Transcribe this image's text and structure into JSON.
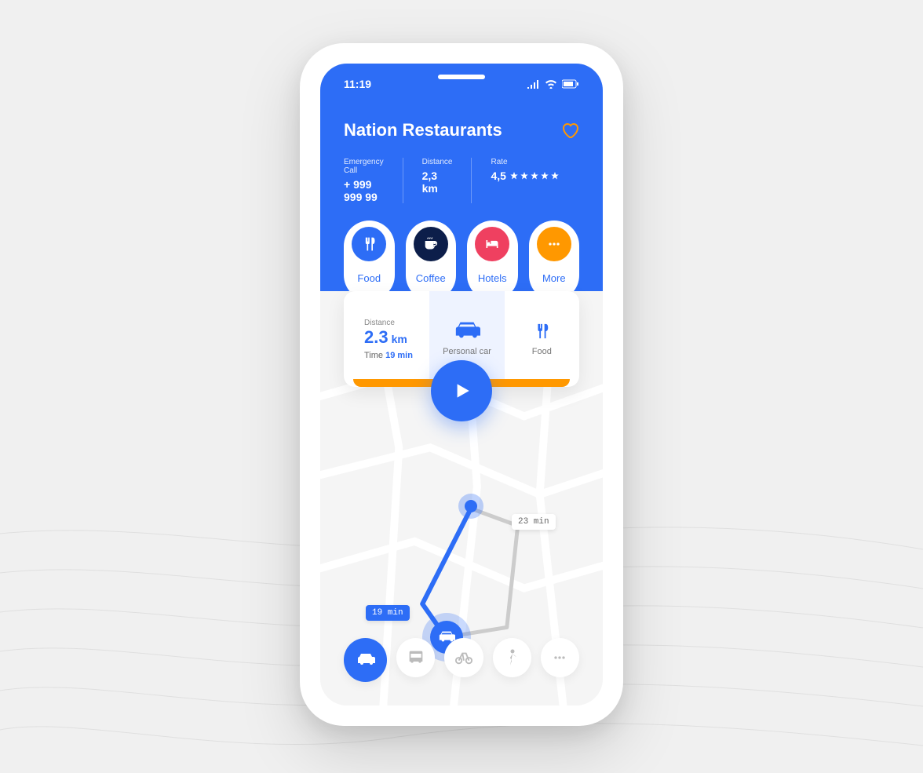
{
  "status": {
    "time": "11:19"
  },
  "place": {
    "title": "Nation Restaurants",
    "emergency_label": "Emergency Call",
    "emergency_number": "+ 999 999 99",
    "distance_label": "Distance",
    "distance_value": "2,3 km",
    "rate_label": "Rate",
    "rate_value": "4,5"
  },
  "categories": [
    {
      "label": "Food",
      "icon": "food",
      "color": "#2d6df6"
    },
    {
      "label": "Coffee",
      "icon": "coffee",
      "color": "#0c1e4a"
    },
    {
      "label": "Hotels",
      "icon": "bed",
      "color": "#ef4060"
    },
    {
      "label": "More",
      "icon": "more",
      "color": "#ff9800"
    }
  ],
  "route": {
    "distance_label": "Distance",
    "distance_value": "2.3",
    "distance_unit": "km",
    "time_label": "Time",
    "time_value": "19 min",
    "mode_label": "Personal car",
    "right_label": "Food"
  },
  "map": {
    "active_time": "19 min",
    "alt_time": "23 min"
  },
  "transport": {
    "modes": [
      "car",
      "bus",
      "bike",
      "walk",
      "more"
    ],
    "active": "car"
  }
}
